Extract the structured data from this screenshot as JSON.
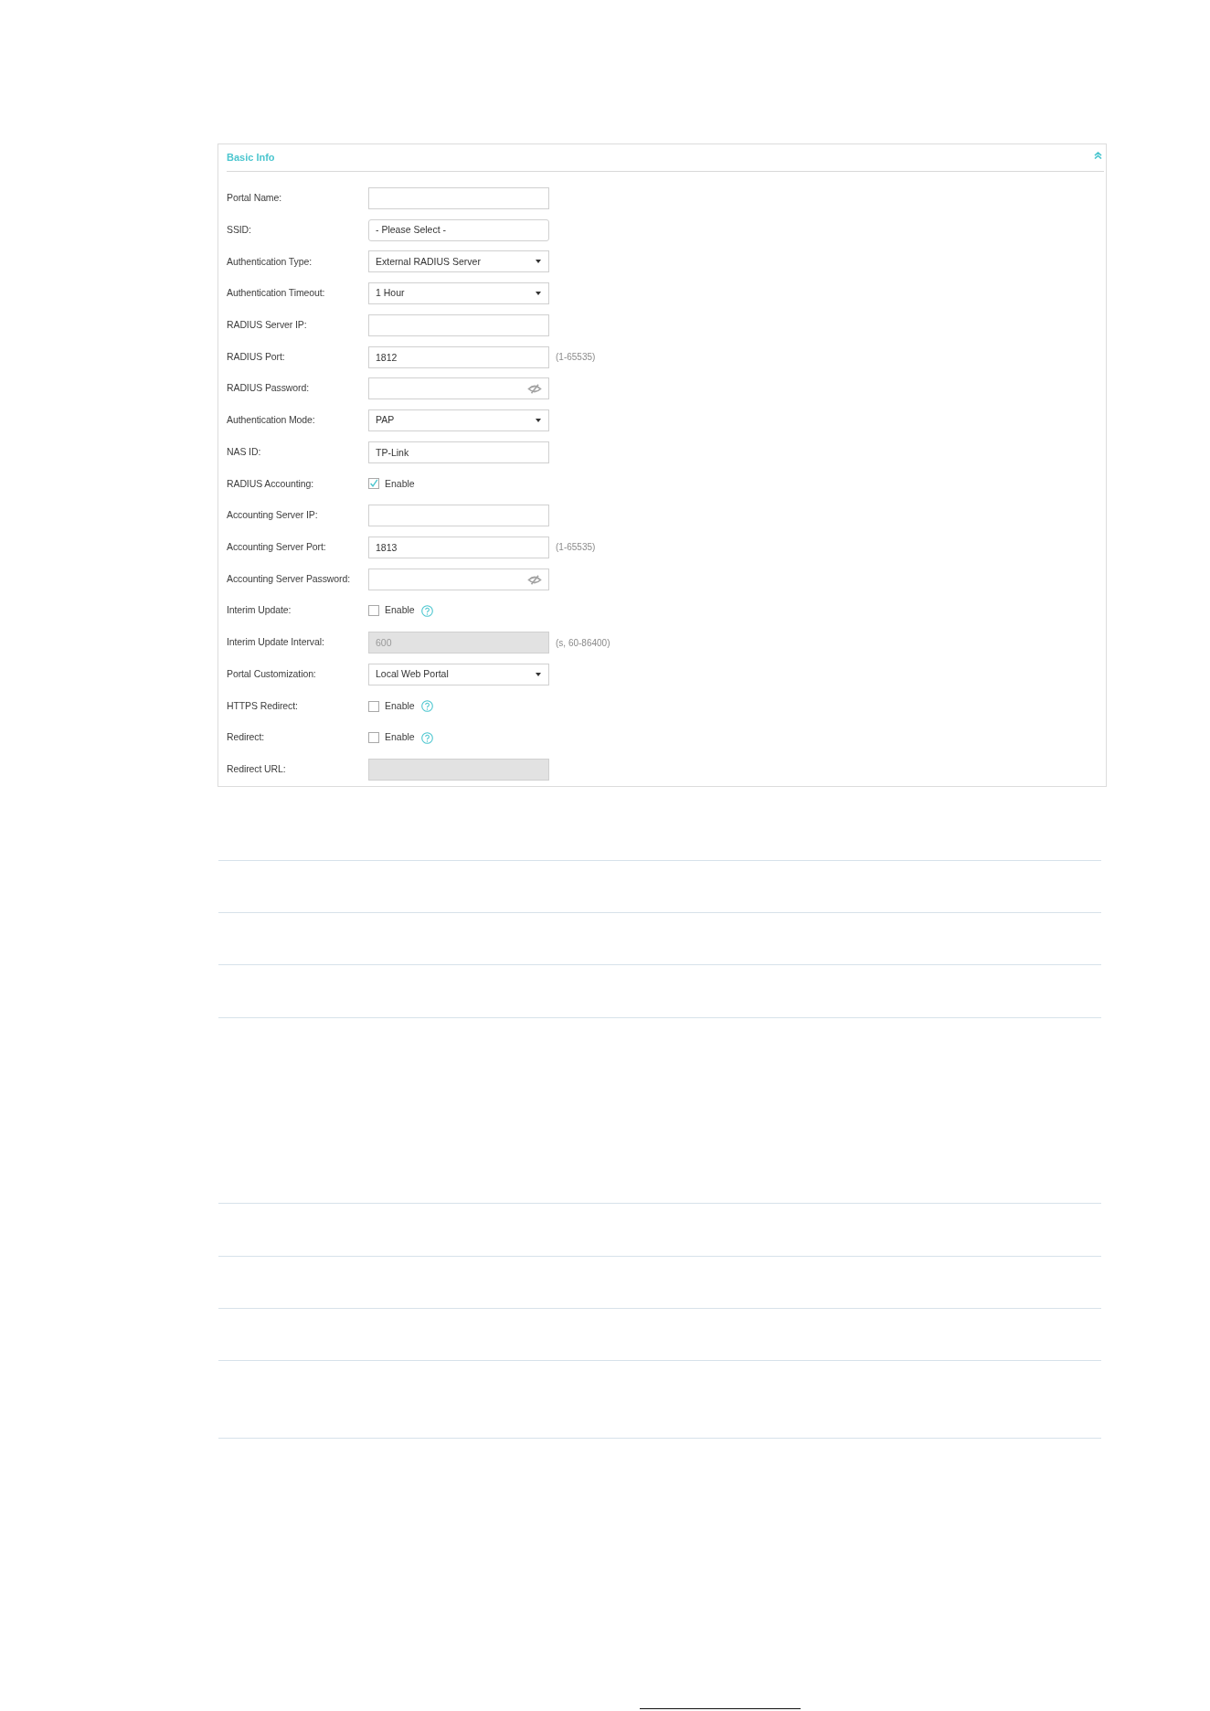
{
  "panel": {
    "title": "Basic Info",
    "expanded": true,
    "fields": [
      {
        "kind": "text",
        "label": "Portal Name:",
        "disabled": false
      },
      {
        "kind": "picker",
        "label": "SSID:",
        "value": "- Please Select -",
        "disabled": false
      },
      {
        "kind": "select",
        "label": "Authentication Type:",
        "value": "External RADIUS Server",
        "disabled": false
      },
      {
        "kind": "select",
        "label": "Authentication Timeout:",
        "value": "1 Hour",
        "disabled": false
      },
      {
        "kind": "text",
        "label": "RADIUS Server IP:",
        "disabled": false
      },
      {
        "kind": "text",
        "label": "RADIUS Port:",
        "value": "1812",
        "hint": "(1-65535)",
        "disabled": false
      },
      {
        "kind": "password",
        "label": "RADIUS Password:",
        "disabled": false
      },
      {
        "kind": "select",
        "label": "Authentication Mode:",
        "value": "PAP",
        "disabled": false
      },
      {
        "kind": "text",
        "label": "NAS ID:",
        "value": "TP-Link",
        "disabled": false
      },
      {
        "kind": "checkbox",
        "label": "RADIUS Accounting:",
        "option": "Enable",
        "checked": true,
        "disabled": false
      },
      {
        "kind": "text",
        "label": "Accounting Server IP:",
        "disabled": false
      },
      {
        "kind": "text",
        "label": "Accounting Server Port:",
        "value": "1813",
        "hint": "(1-65535)",
        "disabled": false
      },
      {
        "kind": "password",
        "label": "Accounting Server Password:",
        "disabled": false
      },
      {
        "kind": "checkbox",
        "label": "Interim Update:",
        "option": "Enable",
        "checked": false,
        "help": true,
        "disabled": false
      },
      {
        "kind": "text",
        "label": "Interim Update Interval:",
        "value": "600",
        "hint": "(s, 60-86400)",
        "disabled": true
      },
      {
        "kind": "select",
        "label": "Portal Customization:",
        "value": "Local Web Portal",
        "disabled": false
      },
      {
        "kind": "checkbox",
        "label": "HTTPS Redirect:",
        "option": "Enable",
        "checked": false,
        "help": true,
        "disabled": false
      },
      {
        "kind": "checkbox",
        "label": "Redirect:",
        "option": "Enable",
        "checked": false,
        "help": true,
        "disabled": false
      },
      {
        "kind": "text",
        "label": "Redirect URL:",
        "disabled": true
      }
    ]
  }
}
